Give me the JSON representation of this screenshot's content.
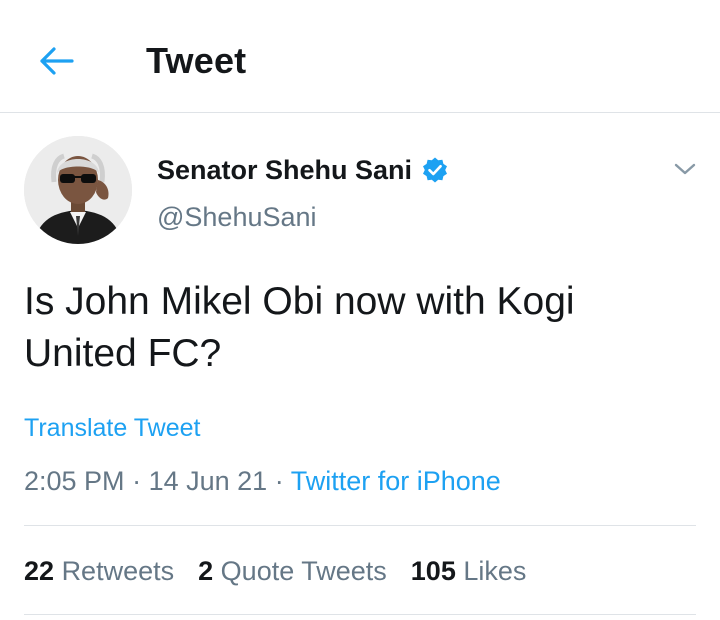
{
  "header": {
    "title": "Tweet"
  },
  "tweet": {
    "author": {
      "display_name": "Senator Shehu Sani",
      "handle": "@ShehuSani",
      "verified": true
    },
    "text": "Is John Mikel Obi now with Kogi United FC?",
    "translate_label": "Translate Tweet",
    "time": "2:05 PM",
    "date": "14 Jun 21",
    "separator": "·",
    "source": "Twitter for iPhone"
  },
  "stats": {
    "retweets": {
      "count": "22",
      "label": "Retweets"
    },
    "quote_tweets": {
      "count": "2",
      "label": "Quote Tweets"
    },
    "likes": {
      "count": "105",
      "label": "Likes"
    }
  },
  "colors": {
    "accent": "#1da1f2",
    "text": "#14171a",
    "secondary": "#657786",
    "divider": "#dfe3e7"
  },
  "icons": {
    "back": "arrow-left-icon",
    "verified": "verified-badge-icon",
    "more": "chevron-down-icon"
  }
}
